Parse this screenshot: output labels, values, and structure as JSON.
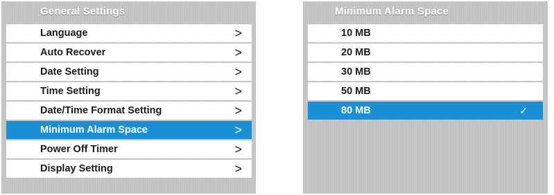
{
  "general_settings": {
    "title": "General Settings",
    "items": [
      {
        "label": "Language",
        "chevron": ">"
      },
      {
        "label": "Auto Recover",
        "chevron": ">"
      },
      {
        "label": "Date Setting",
        "chevron": ">"
      },
      {
        "label": "Time Setting",
        "chevron": ">"
      },
      {
        "label": "Date/Time Format Setting",
        "chevron": ">"
      },
      {
        "label": "Minimum Alarm Space",
        "chevron": ">"
      },
      {
        "label": "Power Off Timer",
        "chevron": ">"
      },
      {
        "label": "Display Setting",
        "chevron": ">"
      }
    ],
    "selected_index": 5
  },
  "alarm_space": {
    "title": "Minimum Alarm Space",
    "options": [
      {
        "label": "10 MB"
      },
      {
        "label": "20 MB"
      },
      {
        "label": "30 MB"
      },
      {
        "label": "50 MB"
      },
      {
        "label": "80 MB",
        "check": "✓"
      }
    ],
    "selected_index": 4
  },
  "colors": {
    "selected_bg": "#1b8fd6",
    "panel_bg": "#c4c4c4",
    "row_bg": "#ffffff"
  }
}
